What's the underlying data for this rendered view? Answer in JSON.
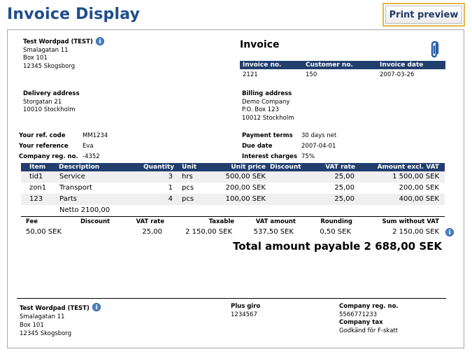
{
  "page": {
    "title": "Invoice Display",
    "print_preview_label": "Print preview"
  },
  "icons": {
    "info": "info-icon",
    "attachment": "paperclip-icon"
  },
  "colors": {
    "title": "#1f4d8c",
    "table_header": "#213e6e",
    "button_border": "#e0b84a",
    "row_alt": "#f0f0f0"
  },
  "sender": {
    "name": "Test Wordpad (TEST)",
    "street": "Smalagatan 11",
    "box": "Box 101",
    "city": "12345 Skogsborg"
  },
  "invoice": {
    "heading": "Invoice",
    "headers": {
      "number": "Invoice no.",
      "customer": "Customer no.",
      "date": "Invoice date"
    },
    "number": "2121",
    "customer": "150",
    "date": "2007-03-26"
  },
  "delivery": {
    "label": "Delivery address",
    "street": "Storgatan 21",
    "city": "10010 Stockholm"
  },
  "billing": {
    "label": "Billing address",
    "company": "Demo Company",
    "box": "P.O. Box 123",
    "city": "10012 Stockholm"
  },
  "refs": {
    "your_ref_code_label": "Your ref. code",
    "your_ref_code": "MM1234",
    "your_reference_label": "Your reference",
    "your_reference": "Eva",
    "company_reg_label": "Company reg. no.",
    "company_reg": "-4352"
  },
  "terms": {
    "payment_terms_label": "Payment terms",
    "payment_terms": "30 days net",
    "due_date_label": "Due date",
    "due_date": "2007-04-01",
    "interest_label": "Interest charges",
    "interest": "75%"
  },
  "items": {
    "headers": {
      "item": "Item",
      "description": "Description",
      "quantity": "Quantity",
      "unit": "Unit",
      "unit_price": "Unit price",
      "discount": "Discount",
      "vat_rate": "VAT rate",
      "amount": "Amount excl. VAT"
    },
    "rows": [
      {
        "item": "tid1",
        "description": "Service",
        "quantity": "3",
        "unit": "hrs",
        "unit_price": "500,00 SEK",
        "discount": "",
        "vat_rate": "25,00",
        "amount": "1 500,00 SEK"
      },
      {
        "item": "zon1",
        "description": "Transport",
        "quantity": "1",
        "unit": "pcs",
        "unit_price": "200,00 SEK",
        "discount": "",
        "vat_rate": "25,00",
        "amount": "200,00 SEK"
      },
      {
        "item": "123",
        "description": "Parts",
        "quantity": "4",
        "unit": "pcs",
        "unit_price": "100,00 SEK",
        "discount": "",
        "vat_rate": "25,00",
        "amount": "400,00 SEK"
      }
    ],
    "netto": "Netto 2100,00"
  },
  "summary": {
    "headers": {
      "fee": "Fee",
      "discount": "Discount",
      "vat_rate": "VAT rate",
      "taxable": "Taxable",
      "vat_amount": "VAT amount",
      "rounding": "Rounding",
      "sum_without_vat": "Sum without VAT"
    },
    "fee": "50,00 SEK",
    "discount": "",
    "vat_rate": "25,00",
    "taxable": "2 150,00 SEK",
    "vat_amount": "537,50 SEK",
    "rounding": "0,50 SEK",
    "sum_without_vat": "2 150,00 SEK",
    "total": "Total amount payable 2 688,00 SEK"
  },
  "footer": {
    "name": "Test Wordpad (TEST)",
    "street": "Smalagatan 11",
    "box": "Box 101",
    "city": "12345 Skogsborg",
    "giro_label": "Plus giro",
    "giro": "1234567",
    "company_reg_label": "Company reg. no.",
    "company_reg": "5566771233",
    "company_tax_label": "Company tax",
    "company_tax": "Godkänd för F-skatt"
  }
}
